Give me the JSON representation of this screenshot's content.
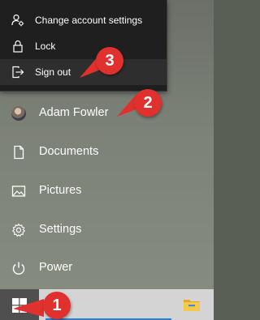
{
  "account_flyout": {
    "items": [
      {
        "label": "Change account settings",
        "icon": "person-gear-icon"
      },
      {
        "label": "Lock",
        "icon": "lock-icon"
      },
      {
        "label": "Sign out",
        "icon": "sign-out-icon"
      }
    ]
  },
  "start_menu": {
    "user": {
      "name": "Adam Fowler",
      "icon": "avatar"
    },
    "items": [
      {
        "label": "Documents",
        "icon": "document-icon"
      },
      {
        "label": "Pictures",
        "icon": "pictures-icon"
      },
      {
        "label": "Settings",
        "icon": "gear-icon"
      },
      {
        "label": "Power",
        "icon": "power-icon"
      }
    ]
  },
  "taskbar": {
    "start_icon": "windows-logo-icon",
    "pinned": [
      {
        "icon": "file-explorer-icon"
      }
    ],
    "accent_color": "#2b7fd4"
  },
  "callouts": [
    {
      "number": "1"
    },
    {
      "number": "2"
    },
    {
      "number": "3"
    }
  ],
  "colors": {
    "callout": "#e0312e",
    "flyout_bg": "#1f1f1f",
    "taskbar_bg": "#d4d4d4"
  }
}
